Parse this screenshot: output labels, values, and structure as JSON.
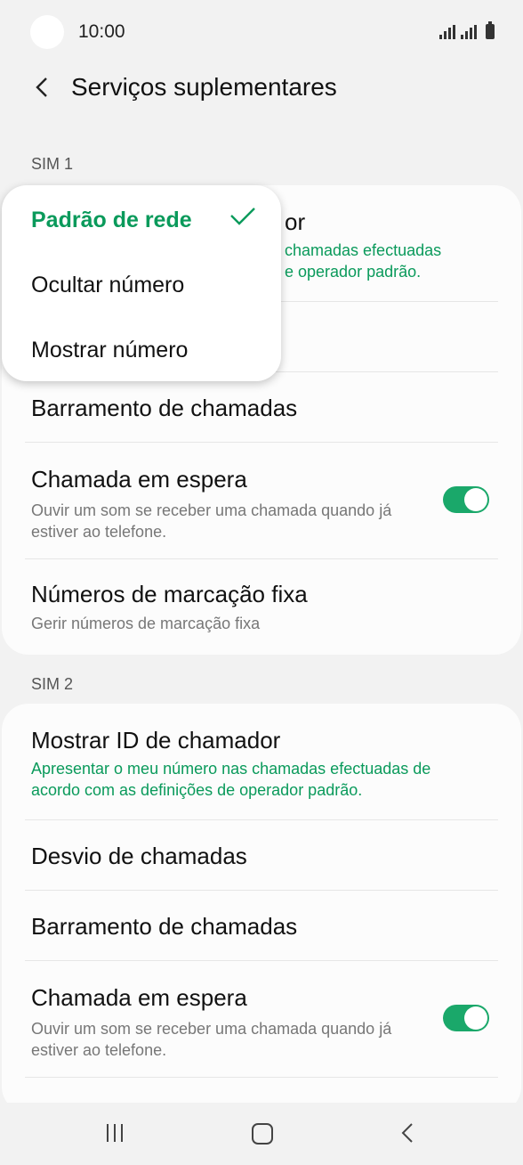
{
  "status": {
    "time": "10:00"
  },
  "header": {
    "title": "Serviços suplementares"
  },
  "sim1": {
    "label": "SIM 1",
    "caller_id": {
      "title_partial": "or",
      "subtitle_line1": "chamadas efectuadas",
      "subtitle_line2": "e operador padrão."
    },
    "call_barring": "Barramento de chamadas",
    "call_waiting": {
      "title": "Chamada em espera",
      "subtitle": "Ouvir um som se receber uma chamada quando já estiver ao telefone.",
      "enabled": true
    },
    "fdn": {
      "title": "Números de marcação fixa",
      "subtitle": "Gerir números de marcação fixa"
    }
  },
  "dropdown": {
    "options": [
      {
        "label": "Padrão de rede",
        "selected": true
      },
      {
        "label": "Ocultar número",
        "selected": false
      },
      {
        "label": "Mostrar número",
        "selected": false
      }
    ]
  },
  "sim2": {
    "label": "SIM 2",
    "caller_id": {
      "title": "Mostrar ID de chamador",
      "subtitle": "Apresentar o meu número nas chamadas efectuadas de acordo com as definições de operador padrão."
    },
    "call_forwarding": "Desvio de chamadas",
    "call_barring": "Barramento de chamadas",
    "call_waiting": {
      "title": "Chamada em espera",
      "subtitle": "Ouvir um som se receber uma chamada quando já estiver ao telefone.",
      "enabled": true
    }
  },
  "colors": {
    "accent": "#0a9a5b",
    "toggle": "#1aa86a",
    "background": "#f2f2f2"
  },
  "icons": [
    "back-chevron-icon",
    "check-icon",
    "recents-icon",
    "home-icon",
    "nav-back-icon"
  ]
}
